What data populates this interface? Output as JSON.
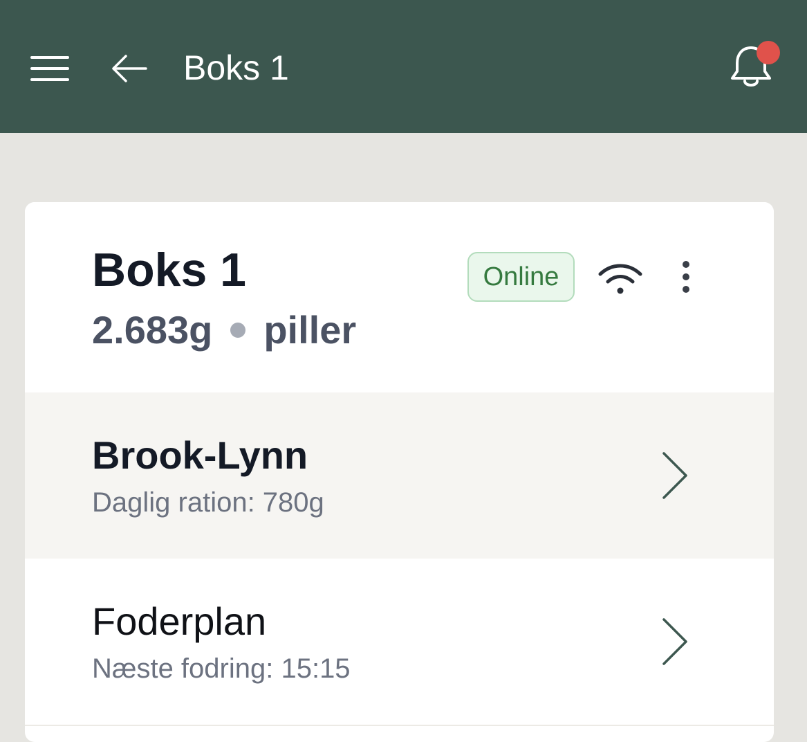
{
  "topbar": {
    "title": "Boks 1",
    "menu_icon": "hamburger-menu-icon",
    "back_icon": "arrow-left-icon",
    "notification_icon": "bell-icon",
    "notification_badge_color": "#e0524b",
    "background_color": "#3c574f"
  },
  "device": {
    "name": "Boks 1",
    "amount": "2.683g",
    "type": "piller",
    "status": "Online",
    "connection_icon": "wifi-icon",
    "more_icon": "vertical-dots-icon"
  },
  "rows": [
    {
      "title": "Brook-Lynn",
      "subtitle": "Daglig ration: 780g",
      "icon": "chevron-right-icon"
    },
    {
      "title": "Foderplan",
      "subtitle": "Næste fodring: 15:15",
      "icon": "chevron-right-icon"
    }
  ]
}
